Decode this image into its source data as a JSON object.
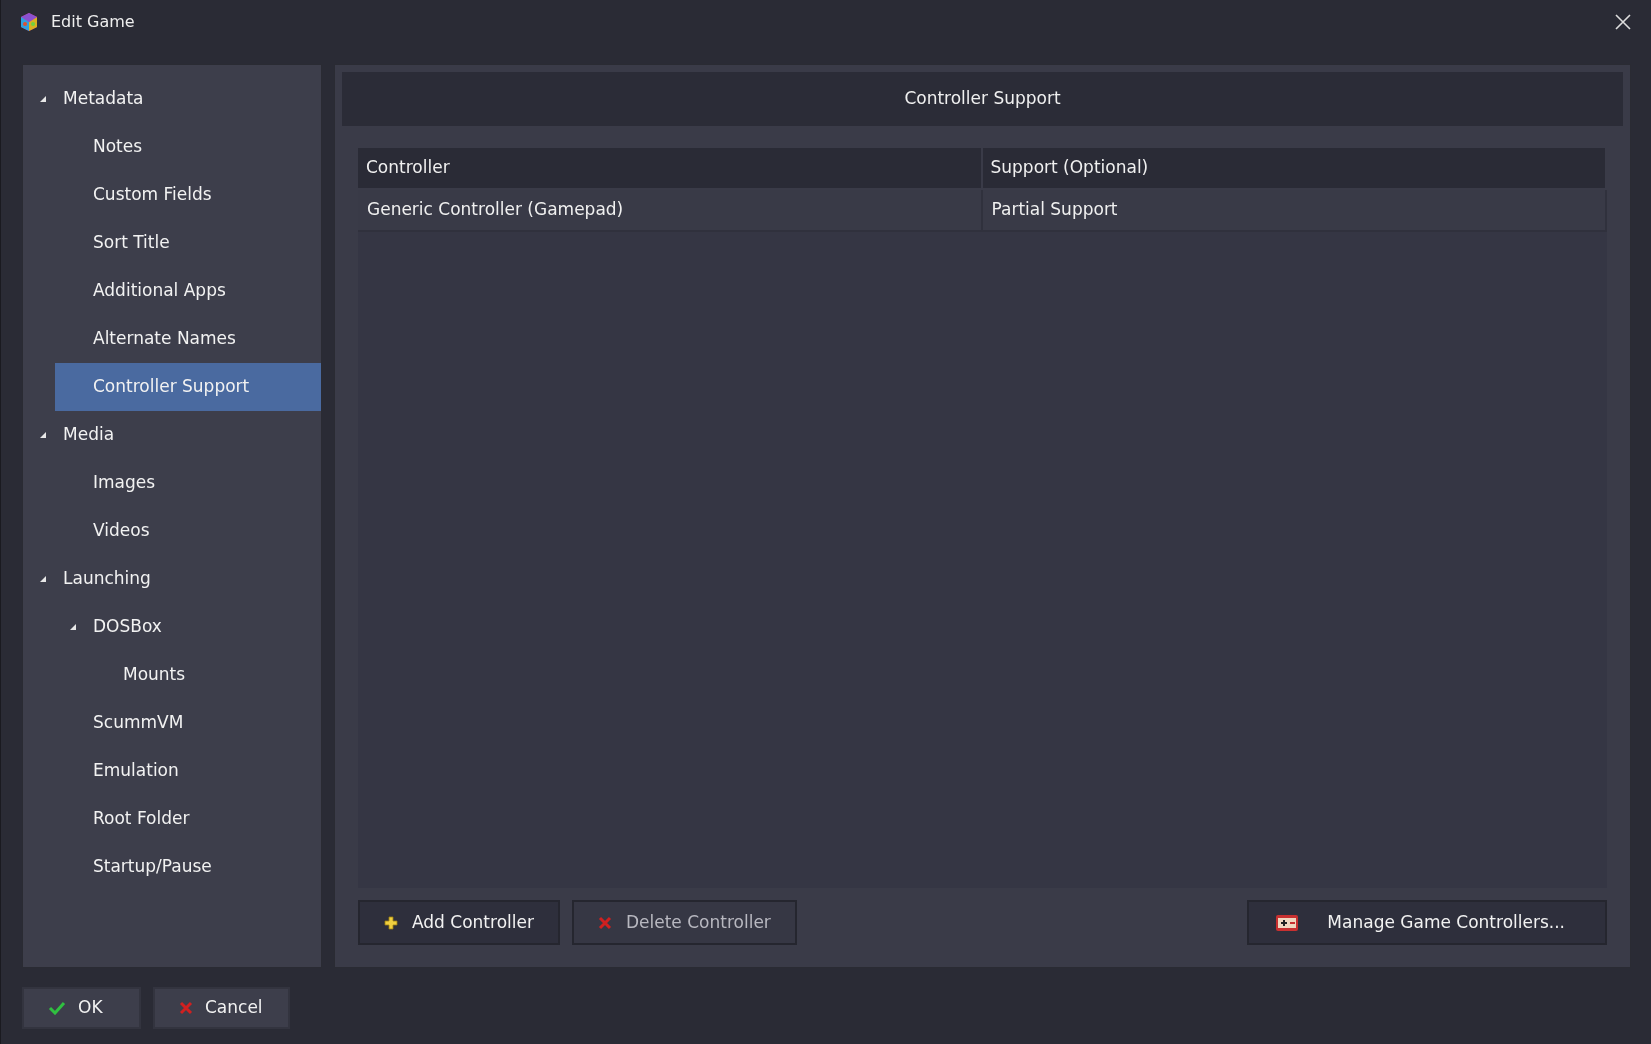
{
  "window": {
    "title": "Edit Game"
  },
  "tree": [
    {
      "label": "Metadata",
      "expanded": true,
      "selected": false,
      "children": [
        {
          "label": "Notes",
          "selected": false
        },
        {
          "label": "Custom Fields",
          "selected": false
        },
        {
          "label": "Sort Title",
          "selected": false
        },
        {
          "label": "Additional Apps",
          "selected": false
        },
        {
          "label": "Alternate Names",
          "selected": false
        },
        {
          "label": "Controller Support",
          "selected": true
        }
      ]
    },
    {
      "label": "Media",
      "expanded": true,
      "selected": false,
      "children": [
        {
          "label": "Images",
          "selected": false
        },
        {
          "label": "Videos",
          "selected": false
        }
      ]
    },
    {
      "label": "Launching",
      "expanded": true,
      "selected": false,
      "children": [
        {
          "label": "DOSBox",
          "expanded": true,
          "selected": false,
          "children": [
            {
              "label": "Mounts",
              "selected": false
            }
          ]
        },
        {
          "label": "ScummVM",
          "selected": false
        },
        {
          "label": "Emulation",
          "selected": false
        },
        {
          "label": "Root Folder",
          "selected": false
        },
        {
          "label": "Startup/Pause",
          "selected": false
        }
      ]
    }
  ],
  "panel": {
    "title": "Controller Support",
    "table": {
      "columns": [
        "Controller",
        "Support (Optional)"
      ],
      "rows": [
        [
          "Generic Controller (Gamepad)",
          "Partial Support"
        ]
      ]
    },
    "buttons": [
      {
        "label": "Add Controller",
        "kind": "add",
        "disabled": false
      },
      {
        "label": "Delete Controller",
        "kind": "delete",
        "disabled": true
      },
      {
        "label": "Manage Game Controllers...",
        "kind": "manage",
        "disabled": false
      }
    ]
  },
  "footer_buttons": [
    {
      "label": "OK",
      "kind": "ok"
    },
    {
      "label": "Cancel",
      "kind": "cancel"
    }
  ]
}
